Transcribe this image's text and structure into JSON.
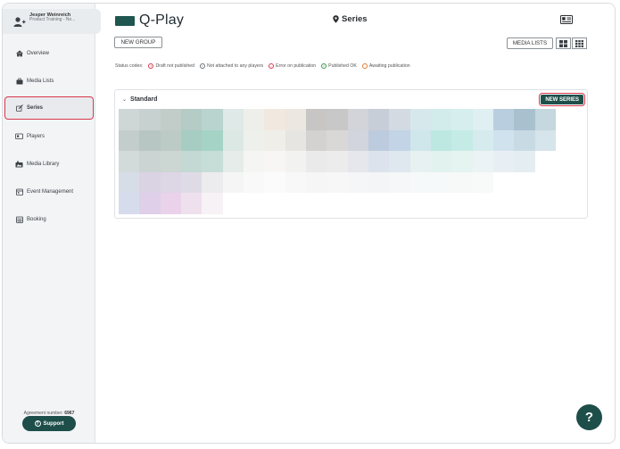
{
  "user": {
    "name": "Jesper Weinreich",
    "subtitle": "Product Training - No..."
  },
  "nav": [
    {
      "label": "Overview",
      "icon": "home-icon"
    },
    {
      "label": "Media Lists",
      "icon": "briefcase-icon"
    },
    {
      "label": "Series",
      "icon": "series-icon",
      "active": true
    },
    {
      "label": "Players",
      "icon": "player-icon"
    },
    {
      "label": "Media Library",
      "icon": "media-library-icon"
    },
    {
      "label": "Event Management",
      "icon": "calendar-icon"
    },
    {
      "label": "Booking",
      "icon": "booking-icon"
    }
  ],
  "agreement": {
    "label": "Agreement number:",
    "number": "6967"
  },
  "support_label": "Support",
  "app_title": "Q-Play",
  "page_title": "Series",
  "toolbar": {
    "new_group": "NEW GROUP",
    "media_lists": "MEDIA LISTS"
  },
  "status": {
    "label": "Status codes:",
    "codes": [
      {
        "text": "Draft not published",
        "color": "#d9374b"
      },
      {
        "text": "Not attached to any players",
        "color": "#6b7075"
      },
      {
        "text": "Error on publication",
        "color": "#d9374b"
      },
      {
        "text": "Published OK",
        "color": "#3a9a4a"
      },
      {
        "text": "Awaiting publication",
        "color": "#e07a2e"
      }
    ]
  },
  "group": {
    "title": "Standard",
    "new_series": "NEW SERIES"
  },
  "help_label": "?",
  "colors": {
    "brand": "#1f4f4a",
    "highlight": "#d9374b"
  }
}
